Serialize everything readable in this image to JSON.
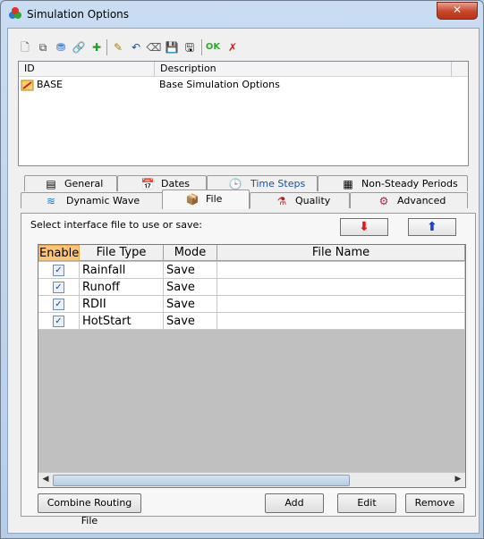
{
  "window": {
    "title": "Simulation Options",
    "close_label": "✕"
  },
  "toolbar": [
    {
      "name": "new-icon",
      "glyph": "🗋",
      "color": "#555"
    },
    {
      "name": "copy-icon",
      "glyph": "⧉",
      "color": "#444"
    },
    {
      "name": "import-icon",
      "glyph": "⛃",
      "color": "#2a6bc1"
    },
    {
      "name": "link-icon",
      "glyph": "🔗",
      "color": "#3c3c3c"
    },
    {
      "name": "add-icon",
      "glyph": "✚",
      "color": "#20a020"
    },
    {
      "name": "edit-icon",
      "glyph": "✎",
      "color": "#b08000"
    },
    {
      "name": "undo-icon",
      "glyph": "↶",
      "color": "#1a4fa0"
    },
    {
      "name": "erase-icon",
      "glyph": "⌫",
      "color": "#555"
    },
    {
      "name": "save-icon",
      "glyph": "💾",
      "color": "#000"
    },
    {
      "name": "save-as-icon",
      "glyph": "🖫",
      "color": "#000"
    },
    {
      "name": "ok-icon",
      "glyph": "OK",
      "color": "#2eaa2e"
    },
    {
      "name": "cancel-icon",
      "glyph": "✗",
      "color": "#e01818"
    }
  ],
  "list": {
    "columns": [
      "ID",
      "Description"
    ],
    "rows": [
      {
        "id": "BASE",
        "description": "Base Simulation Options"
      }
    ]
  },
  "tabs": {
    "row1": [
      {
        "label": "General",
        "icon": "general-icon",
        "glyph": "▤"
      },
      {
        "label": "Dates",
        "icon": "dates-icon",
        "glyph": "📅"
      },
      {
        "label": "Time Steps",
        "icon": "clock-icon",
        "glyph": "🕒",
        "color": "#1a4fa0"
      },
      {
        "label": "Non-Steady Periods",
        "icon": "calendar-icon",
        "glyph": "▦"
      }
    ],
    "row2": [
      {
        "label": "Dynamic Wave",
        "icon": "wave-icon",
        "glyph": "≋"
      },
      {
        "label": "File",
        "icon": "file-icon",
        "glyph": "📦"
      },
      {
        "label": "Quality",
        "icon": "quality-icon",
        "glyph": "⚗"
      },
      {
        "label": "Advanced",
        "icon": "advanced-icon",
        "glyph": "⚙"
      }
    ],
    "active": "File"
  },
  "panel": {
    "hint": "Select interface file to use or save:",
    "down_arrow": "⬇",
    "up_arrow": "⬆"
  },
  "grid": {
    "headers": [
      "Enable",
      "File Type",
      "Mode",
      "File Name"
    ],
    "rows": [
      {
        "enabled": true,
        "file_type": "Rainfall",
        "mode": "Save",
        "file_name": ""
      },
      {
        "enabled": true,
        "file_type": "Runoff",
        "mode": "Save",
        "file_name": ""
      },
      {
        "enabled": true,
        "file_type": "RDII",
        "mode": "Save",
        "file_name": ""
      },
      {
        "enabled": true,
        "file_type": "HotStart",
        "mode": "Save",
        "file_name": ""
      }
    ]
  },
  "buttons": {
    "combine": "Combine Routing File",
    "add": "Add",
    "edit": "Edit",
    "remove": "Remove"
  },
  "colors": {
    "enable_header": "#fbc478",
    "close_button": "#c8452a"
  }
}
